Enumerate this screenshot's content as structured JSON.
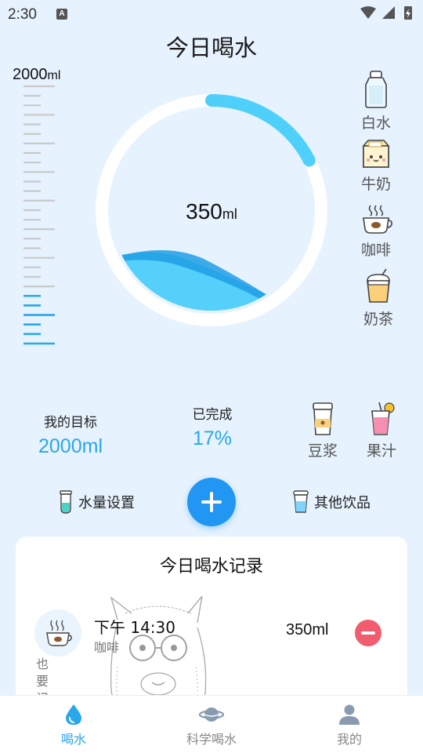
{
  "status_bar": {
    "time": "2:30",
    "notification_badge": "A"
  },
  "header": {
    "title": "今日喝水"
  },
  "goal_scale": {
    "max_value": "2000",
    "max_unit": "ml"
  },
  "progress": {
    "amount": "350",
    "unit": "ml",
    "fraction": 0.175
  },
  "side_drinks": [
    {
      "label": "白水",
      "icon": "water-bottle-icon"
    },
    {
      "label": "牛奶",
      "icon": "milk-carton-icon"
    },
    {
      "label": "咖啡",
      "icon": "coffee-cup-icon"
    },
    {
      "label": "奶茶",
      "icon": "milk-tea-icon"
    }
  ],
  "stats": {
    "goal_label": "我的目标",
    "goal_value": "2000ml",
    "done_label": "已完成",
    "done_value": "17%"
  },
  "extra_drinks": [
    {
      "label": "豆浆",
      "icon": "soy-milk-icon"
    },
    {
      "label": "果汁",
      "icon": "juice-glass-icon"
    }
  ],
  "actions": {
    "water_settings": "水量设置",
    "other_drinks": "其他饮品"
  },
  "records": {
    "title": "今日喝水记录",
    "watermark_text": "也要记",
    "items": [
      {
        "time": "下午 14:30",
        "drink": "咖啡",
        "amount": "350ml",
        "icon": "coffee-cup-icon"
      }
    ]
  },
  "nav": {
    "items": [
      {
        "label": "喝水",
        "icon": "water-drop-icon",
        "active": true
      },
      {
        "label": "科学喝水",
        "icon": "planet-icon",
        "active": false
      },
      {
        "label": "我的",
        "icon": "person-icon",
        "active": false
      }
    ]
  },
  "colors": {
    "accent": "#29a7ea",
    "primary_button": "#2196f3",
    "ring": "#4fd0fb",
    "delete": "#f15c6e"
  }
}
